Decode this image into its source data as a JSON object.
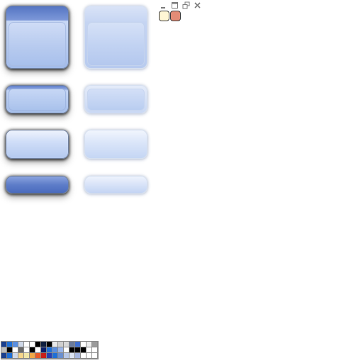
{
  "colors": {
    "swatch_light": "#fff6d5",
    "swatch_accent": "#e38c76",
    "caption_glyph": "#7a7a7a"
  },
  "caption_buttons": [
    {
      "name": "minimize",
      "icon": "minimize-icon"
    },
    {
      "name": "maximize",
      "icon": "maximize-icon"
    },
    {
      "name": "restore",
      "icon": "restore-icon"
    },
    {
      "name": "close",
      "icon": "close-icon"
    }
  ],
  "palette": {
    "rows": [
      [
        "#1a3f8f",
        "#1f6fd6",
        "#5a8fe0",
        "#cfd8e8",
        "#ffffff",
        "#ffffff",
        "#000000",
        "#0f1f3f",
        "#000000",
        "#e8e8e8",
        "#cfcfcf",
        "#d8d8d8",
        "#6a7a9a",
        "#3f6fcf",
        "#ffffff",
        "#eeeeee",
        "#9a9a9a"
      ],
      [
        "#bdbdbd",
        "#000000",
        "#ffffff",
        "#6a6a6a",
        "#ffffff",
        "#000000",
        "#ffffff",
        "#0a1f6a",
        "#1f6fd6",
        "#5a8fe0",
        "#9ab5e8",
        "#ffffff",
        "#000000",
        "#000000",
        "#000000",
        "#ffffff",
        "#ffffff"
      ],
      [
        "#1a3f8f",
        "#1f6fd6",
        "#cfd8e8",
        "#f5d58a",
        "#f1e6a8",
        "#f0a848",
        "#e85a28",
        "#c8201a",
        "#2a3faf",
        "#1f6fd6",
        "#6a8fcf",
        "#b8c8e8",
        "#dce4f2",
        "#a8b8e0",
        "#ffffff",
        "#ffffff",
        "#ffffff"
      ]
    ]
  }
}
